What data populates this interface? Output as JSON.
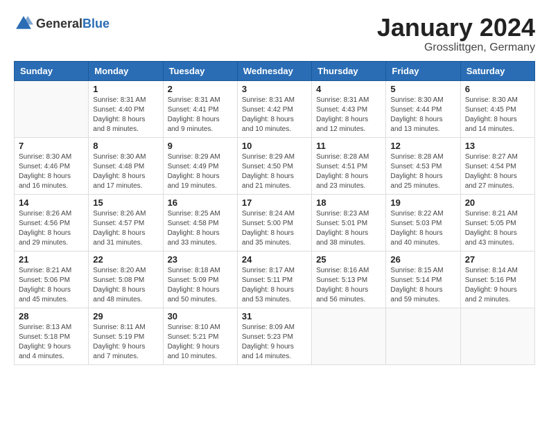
{
  "header": {
    "logo_general": "General",
    "logo_blue": "Blue",
    "month": "January 2024",
    "location": "Grosslittgen, Germany"
  },
  "days_of_week": [
    "Sunday",
    "Monday",
    "Tuesday",
    "Wednesday",
    "Thursday",
    "Friday",
    "Saturday"
  ],
  "weeks": [
    [
      {
        "day": "",
        "info": ""
      },
      {
        "day": "1",
        "info": "Sunrise: 8:31 AM\nSunset: 4:40 PM\nDaylight: 8 hours\nand 8 minutes."
      },
      {
        "day": "2",
        "info": "Sunrise: 8:31 AM\nSunset: 4:41 PM\nDaylight: 8 hours\nand 9 minutes."
      },
      {
        "day": "3",
        "info": "Sunrise: 8:31 AM\nSunset: 4:42 PM\nDaylight: 8 hours\nand 10 minutes."
      },
      {
        "day": "4",
        "info": "Sunrise: 8:31 AM\nSunset: 4:43 PM\nDaylight: 8 hours\nand 12 minutes."
      },
      {
        "day": "5",
        "info": "Sunrise: 8:30 AM\nSunset: 4:44 PM\nDaylight: 8 hours\nand 13 minutes."
      },
      {
        "day": "6",
        "info": "Sunrise: 8:30 AM\nSunset: 4:45 PM\nDaylight: 8 hours\nand 14 minutes."
      }
    ],
    [
      {
        "day": "7",
        "info": "Sunrise: 8:30 AM\nSunset: 4:46 PM\nDaylight: 8 hours\nand 16 minutes."
      },
      {
        "day": "8",
        "info": "Sunrise: 8:30 AM\nSunset: 4:48 PM\nDaylight: 8 hours\nand 17 minutes."
      },
      {
        "day": "9",
        "info": "Sunrise: 8:29 AM\nSunset: 4:49 PM\nDaylight: 8 hours\nand 19 minutes."
      },
      {
        "day": "10",
        "info": "Sunrise: 8:29 AM\nSunset: 4:50 PM\nDaylight: 8 hours\nand 21 minutes."
      },
      {
        "day": "11",
        "info": "Sunrise: 8:28 AM\nSunset: 4:51 PM\nDaylight: 8 hours\nand 23 minutes."
      },
      {
        "day": "12",
        "info": "Sunrise: 8:28 AM\nSunset: 4:53 PM\nDaylight: 8 hours\nand 25 minutes."
      },
      {
        "day": "13",
        "info": "Sunrise: 8:27 AM\nSunset: 4:54 PM\nDaylight: 8 hours\nand 27 minutes."
      }
    ],
    [
      {
        "day": "14",
        "info": "Sunrise: 8:26 AM\nSunset: 4:56 PM\nDaylight: 8 hours\nand 29 minutes."
      },
      {
        "day": "15",
        "info": "Sunrise: 8:26 AM\nSunset: 4:57 PM\nDaylight: 8 hours\nand 31 minutes."
      },
      {
        "day": "16",
        "info": "Sunrise: 8:25 AM\nSunset: 4:58 PM\nDaylight: 8 hours\nand 33 minutes."
      },
      {
        "day": "17",
        "info": "Sunrise: 8:24 AM\nSunset: 5:00 PM\nDaylight: 8 hours\nand 35 minutes."
      },
      {
        "day": "18",
        "info": "Sunrise: 8:23 AM\nSunset: 5:01 PM\nDaylight: 8 hours\nand 38 minutes."
      },
      {
        "day": "19",
        "info": "Sunrise: 8:22 AM\nSunset: 5:03 PM\nDaylight: 8 hours\nand 40 minutes."
      },
      {
        "day": "20",
        "info": "Sunrise: 8:21 AM\nSunset: 5:05 PM\nDaylight: 8 hours\nand 43 minutes."
      }
    ],
    [
      {
        "day": "21",
        "info": "Sunrise: 8:21 AM\nSunset: 5:06 PM\nDaylight: 8 hours\nand 45 minutes."
      },
      {
        "day": "22",
        "info": "Sunrise: 8:20 AM\nSunset: 5:08 PM\nDaylight: 8 hours\nand 48 minutes."
      },
      {
        "day": "23",
        "info": "Sunrise: 8:18 AM\nSunset: 5:09 PM\nDaylight: 8 hours\nand 50 minutes."
      },
      {
        "day": "24",
        "info": "Sunrise: 8:17 AM\nSunset: 5:11 PM\nDaylight: 8 hours\nand 53 minutes."
      },
      {
        "day": "25",
        "info": "Sunrise: 8:16 AM\nSunset: 5:13 PM\nDaylight: 8 hours\nand 56 minutes."
      },
      {
        "day": "26",
        "info": "Sunrise: 8:15 AM\nSunset: 5:14 PM\nDaylight: 8 hours\nand 59 minutes."
      },
      {
        "day": "27",
        "info": "Sunrise: 8:14 AM\nSunset: 5:16 PM\nDaylight: 9 hours\nand 2 minutes."
      }
    ],
    [
      {
        "day": "28",
        "info": "Sunrise: 8:13 AM\nSunset: 5:18 PM\nDaylight: 9 hours\nand 4 minutes."
      },
      {
        "day": "29",
        "info": "Sunrise: 8:11 AM\nSunset: 5:19 PM\nDaylight: 9 hours\nand 7 minutes."
      },
      {
        "day": "30",
        "info": "Sunrise: 8:10 AM\nSunset: 5:21 PM\nDaylight: 9 hours\nand 10 minutes."
      },
      {
        "day": "31",
        "info": "Sunrise: 8:09 AM\nSunset: 5:23 PM\nDaylight: 9 hours\nand 14 minutes."
      },
      {
        "day": "",
        "info": ""
      },
      {
        "day": "",
        "info": ""
      },
      {
        "day": "",
        "info": ""
      }
    ]
  ]
}
